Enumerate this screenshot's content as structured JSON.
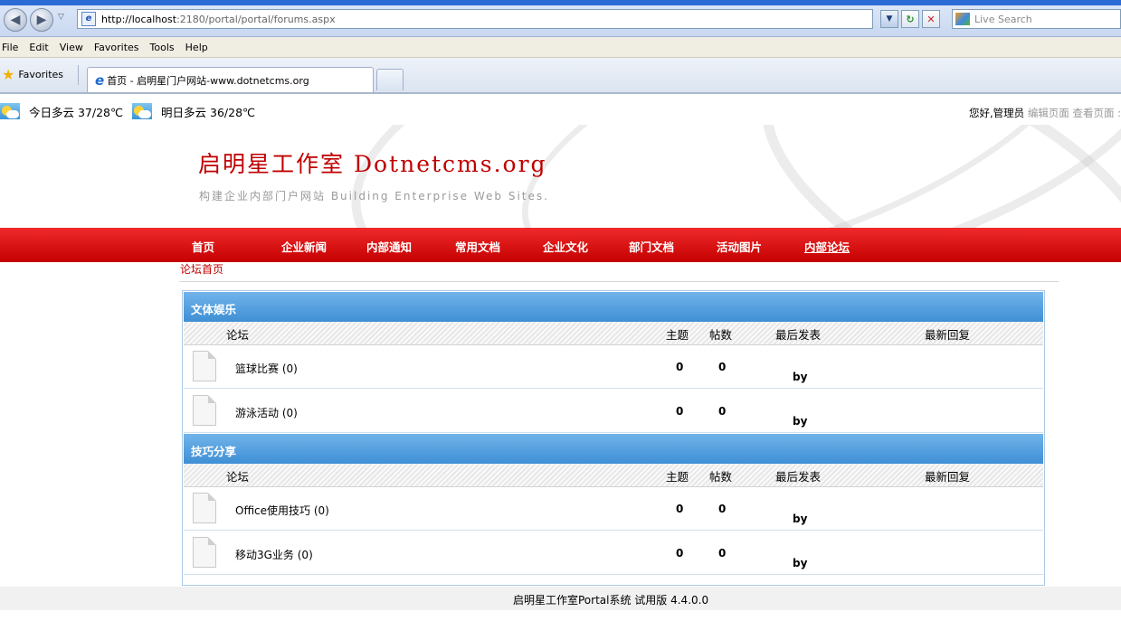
{
  "browser": {
    "url_host": "http://localhost",
    "url_rest": ":2180/portal/portal/forums.aspx",
    "search_placeholder": "Live Search",
    "menu": [
      "File",
      "Edit",
      "View",
      "Favorites",
      "Tools",
      "Help"
    ],
    "favorites_label": "Favorites",
    "tab_title": "首页 - 启明星门户网站-www.dotnetcms.org"
  },
  "weather": {
    "today": "今日多云 37/28℃",
    "tomorrow": "明日多云 36/28℃"
  },
  "user": {
    "greeting": "您好,管理员",
    "links": "编辑页面 查看页面 :"
  },
  "brand": {
    "title": "启明星工作室 Dotnetcms.org",
    "subtitle": "构建企业内部门户网站 Building Enterprise Web Sites."
  },
  "nav": [
    "首页",
    "企业新闻",
    "内部通知",
    "常用文档",
    "企业文化",
    "部门文档",
    "活动图片",
    "内部论坛"
  ],
  "breadcrumb": "论坛首页",
  "columns": {
    "forum": "论坛",
    "topics": "主题",
    "posts": "帖数",
    "last_post": "最后发表",
    "latest_reply": "最新回复"
  },
  "categories": [
    {
      "name": "文体娱乐",
      "forums": [
        {
          "name": "篮球比赛 (0)",
          "topics": "0",
          "posts": "0",
          "by": "by"
        },
        {
          "name": "游泳活动 (0)",
          "topics": "0",
          "posts": "0",
          "by": "by"
        }
      ]
    },
    {
      "name": "技巧分享",
      "forums": [
        {
          "name": "Office使用技巧 (0)",
          "topics": "0",
          "posts": "0",
          "by": "by"
        },
        {
          "name": "移动3G业务 (0)",
          "topics": "0",
          "posts": "0",
          "by": "by"
        }
      ]
    }
  ],
  "footer": "启明星工作室Portal系统 试用版 4.4.0.0"
}
